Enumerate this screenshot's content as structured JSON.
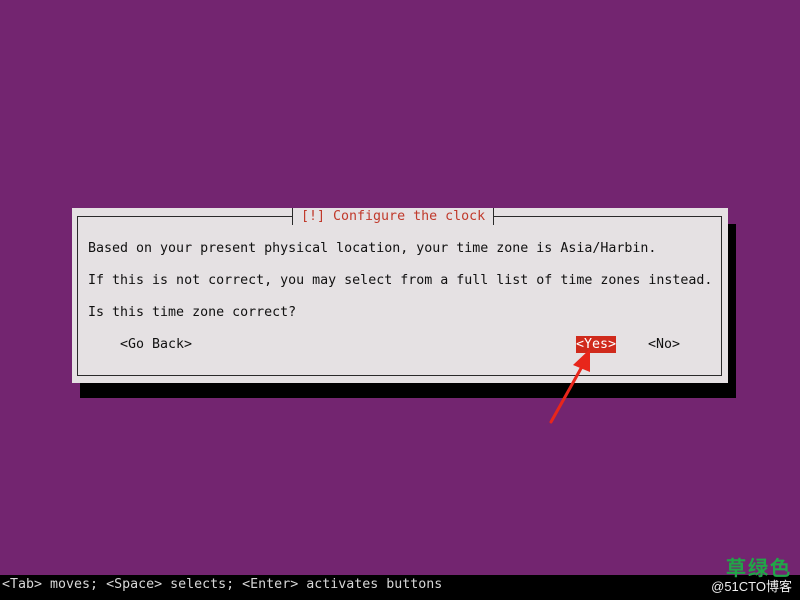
{
  "screen": {
    "background_color": "#732570"
  },
  "dialog": {
    "title": "[!] Configure the clock",
    "lines": [
      "Based on your present physical location, your time zone is Asia/Harbin.",
      "If this is not correct, you may select from a full list of time zones instead.",
      "Is this time zone correct?"
    ],
    "buttons": {
      "go_back": "<Go Back>",
      "yes": "<Yes>",
      "no": "<No>"
    },
    "selected_button": "yes",
    "title_color": "#c0392b",
    "selected_color": "#d02a1c"
  },
  "status_bar": {
    "text": "<Tab> moves; <Space> selects; <Enter> activates buttons"
  },
  "annotation": {
    "arrow_color": "#e8261b"
  },
  "watermark": {
    "main": "草绿色",
    "sub": "@51CTO博客"
  }
}
